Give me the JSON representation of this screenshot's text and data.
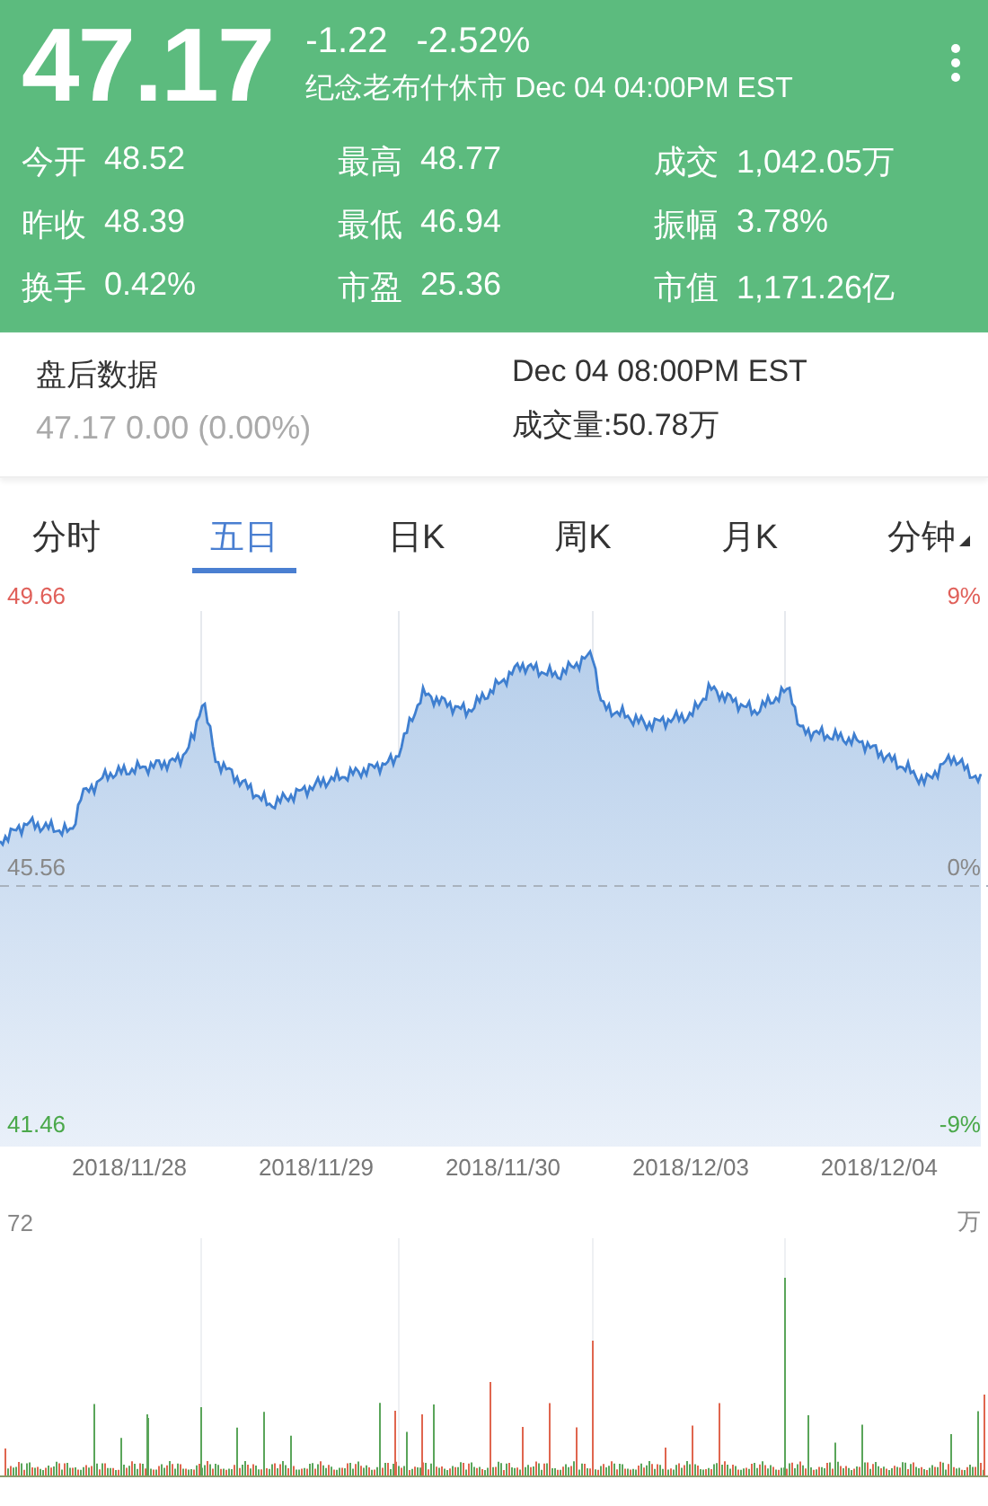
{
  "quote": {
    "price": "47.17",
    "change": "-1.22",
    "change_pct": "-2.52%",
    "status": "纪念老布什休市 Dec 04 04:00PM EST"
  },
  "stats": [
    {
      "label": "今开",
      "value": "48.52"
    },
    {
      "label": "最高",
      "value": "48.77"
    },
    {
      "label": "成交",
      "value": "1,042.05万"
    },
    {
      "label": "昨收",
      "value": "48.39"
    },
    {
      "label": "最低",
      "value": "46.94"
    },
    {
      "label": "振幅",
      "value": "3.78%"
    },
    {
      "label": "换手",
      "value": "0.42%"
    },
    {
      "label": "市盈",
      "value": "25.36"
    },
    {
      "label": "市值",
      "value": "1,171.26亿"
    }
  ],
  "after_hours": {
    "title": "盘后数据",
    "quote": "47.17 0.00 (0.00%)",
    "time": "Dec 04 08:00PM EST",
    "volume": "成交量:50.78万"
  },
  "tabs": [
    {
      "label": "分时",
      "selected": false,
      "kind": "plain"
    },
    {
      "label": "五日",
      "selected": true,
      "kind": "plain"
    },
    {
      "label": "日K",
      "selected": false,
      "kind": "plain"
    },
    {
      "label": "周K",
      "selected": false,
      "kind": "plain"
    },
    {
      "label": "月K",
      "selected": false,
      "kind": "plain"
    },
    {
      "label": "分钟",
      "selected": false,
      "kind": "dropdown"
    }
  ],
  "price_chart": {
    "y_max": "49.66",
    "y_mid": "45.56",
    "y_min": "41.46",
    "pct_max": "9%",
    "pct_mid": "0%",
    "pct_min": "-9%",
    "dates": [
      "2018/11/28",
      "2018/11/29",
      "2018/11/30",
      "2018/12/03",
      "2018/12/04"
    ]
  },
  "volume_chart": {
    "y_max": "72",
    "unit": "万"
  }
}
